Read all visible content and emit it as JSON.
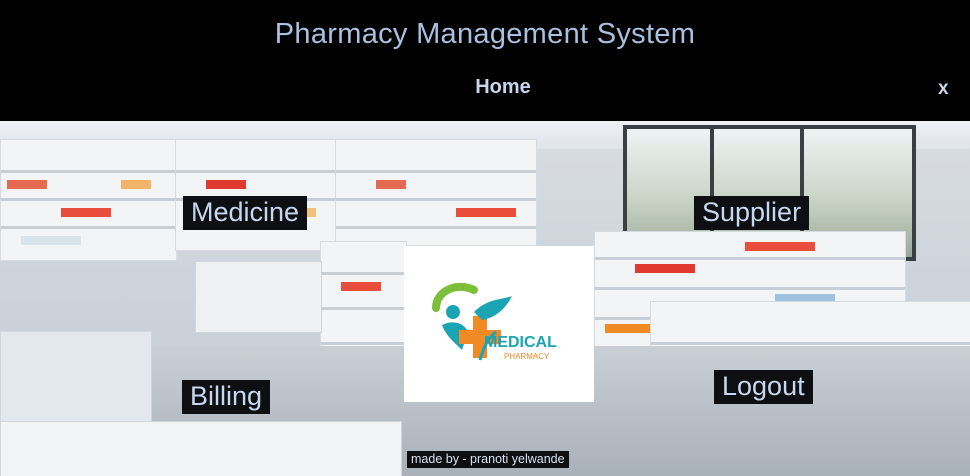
{
  "header": {
    "title": "Pharmacy Management System",
    "subtitle": "Home",
    "close_label": "x"
  },
  "menu": {
    "medicine": "Medicine",
    "supplier": "Supplier",
    "billing": "Billing",
    "logout": "Logout"
  },
  "logo": {
    "word1": "MEDICAL",
    "word2": "PHARMACY",
    "colors": {
      "green": "#7cbf3a",
      "teal": "#1aa4b4",
      "orange": "#f08a24"
    }
  },
  "footer": {
    "credit": "made by - pranoti yelwande"
  },
  "colors": {
    "header_bg": "#000000",
    "title": "#a9c0e0",
    "label_bg": "#0d0f12"
  }
}
